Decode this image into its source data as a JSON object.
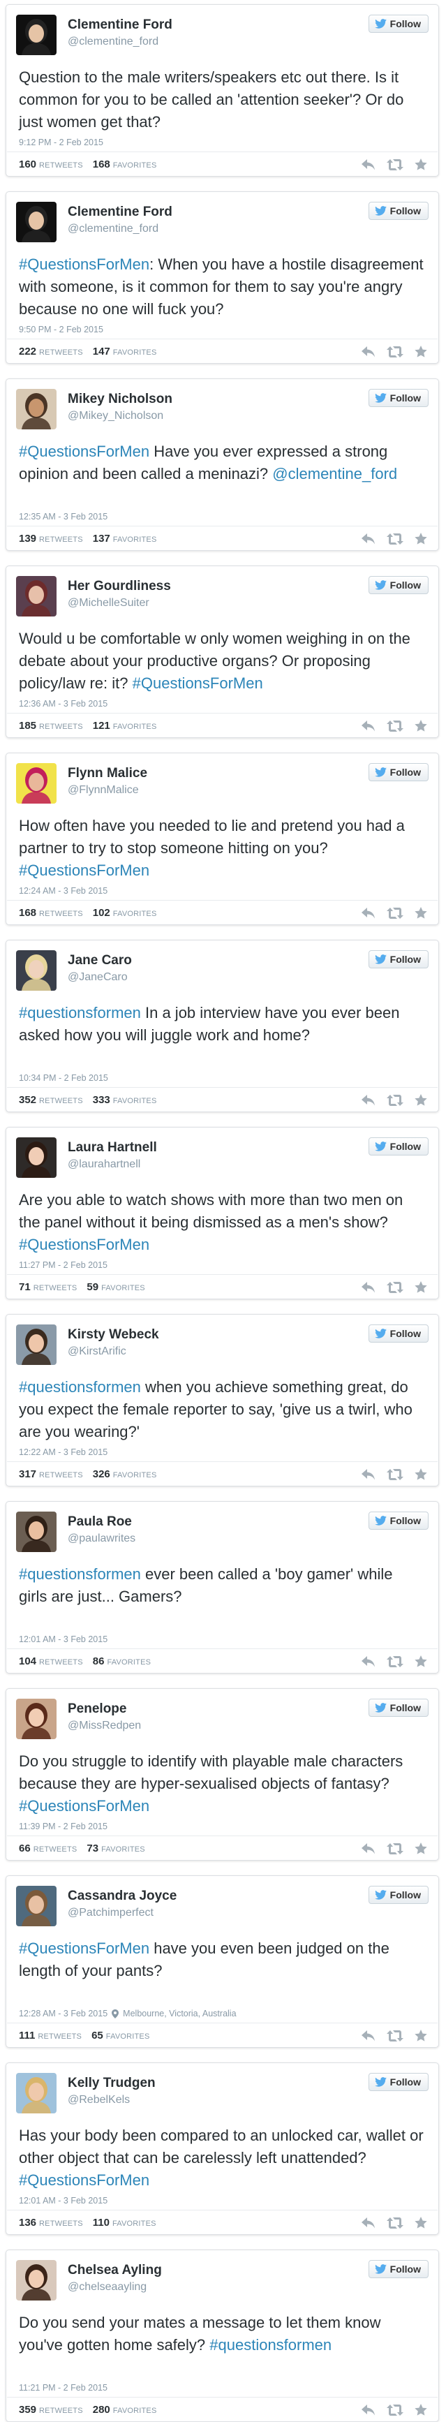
{
  "follow_label": "Follow",
  "retweets_label": "RETWEETS",
  "favorites_label": "FAVORITES",
  "colors": {
    "link": "#2c85b8",
    "twitter_blue": "#55acee",
    "muted": "#8899a6"
  },
  "tweets": [
    {
      "name": "Clementine Ford",
      "handle": "@clementine_ford",
      "parts": [
        {
          "t": "text",
          "v": "Question to the male writers/speakers etc out there. Is it common for you to be called an 'attention seeker'? Or do just women get that?"
        }
      ],
      "time": "9:12 PM - 2 Feb 2015",
      "location": "",
      "retweets": "160",
      "favorites": "168",
      "avatar": {
        "bg": "#101010",
        "face": "#e6c4a6",
        "hair": "#222222"
      }
    },
    {
      "name": "Clementine Ford",
      "handle": "@clementine_ford",
      "parts": [
        {
          "t": "tag",
          "v": "#QuestionsForMen"
        },
        {
          "t": "text",
          "v": ": When you have a hostile disagreement with someone, is it common for them to say you're angry because no one will fuck you?"
        }
      ],
      "time": "9:50 PM - 2 Feb 2015",
      "location": "",
      "retweets": "222",
      "favorites": "147",
      "avatar": {
        "bg": "#101010",
        "face": "#e6c4a6",
        "hair": "#222222"
      }
    },
    {
      "name": "Mikey Nicholson",
      "handle": "@Mikey_Nicholson",
      "parts": [
        {
          "t": "tag",
          "v": "#QuestionsForMen"
        },
        {
          "t": "text",
          "v": " Have you ever expressed a strong opinion and been called a meninazi? "
        },
        {
          "t": "mention",
          "v": "@clementine_ford"
        }
      ],
      "time": "12:35 AM - 3 Feb 2015",
      "location": "",
      "retweets": "139",
      "favorites": "137",
      "avatar": {
        "bg": "#d8c9b4",
        "face": "#c8966e",
        "hair": "#4a3526"
      }
    },
    {
      "name": "Her Gourdliness",
      "handle": "@MichelleSuiter",
      "parts": [
        {
          "t": "text",
          "v": "Would u be comfortable w only women weighing in on the debate about your productive organs? Or proposing policy/law re: it? "
        },
        {
          "t": "tag",
          "v": "#QuestionsForMen"
        }
      ],
      "time": "12:36 AM - 3 Feb 2015",
      "location": "",
      "retweets": "185",
      "favorites": "121",
      "avatar": {
        "bg": "#5a3f4e",
        "face": "#e7c0aa",
        "hair": "#6d2b2b"
      }
    },
    {
      "name": "Flynn Malice",
      "handle": "@FlynnMalice",
      "parts": [
        {
          "t": "text",
          "v": "How often have you needed to lie and pretend you had a partner to try to stop someone hitting on you? "
        },
        {
          "t": "tag",
          "v": "#QuestionsForMen"
        }
      ],
      "time": "12:24 AM - 3 Feb 2015",
      "location": "",
      "retweets": "168",
      "favorites": "102",
      "avatar": {
        "bg": "#f1e24a",
        "face": "#e9b79a",
        "hair": "#c21f5a"
      }
    },
    {
      "name": "Jane Caro",
      "handle": "@JaneCaro",
      "parts": [
        {
          "t": "tag",
          "v": "#questionsformen"
        },
        {
          "t": "text",
          "v": " In a job interview have you ever been asked how you will juggle work and home?"
        }
      ],
      "time": "10:34 PM - 2 Feb 2015",
      "location": "",
      "retweets": "352",
      "favorites": "333",
      "avatar": {
        "bg": "#3a3f4a",
        "face": "#efd2bd",
        "hair": "#e7d59a"
      }
    },
    {
      "name": "Laura Hartnell",
      "handle": "@laurahartnell",
      "parts": [
        {
          "t": "text",
          "v": "Are you able to watch shows with more than two men on the panel without it being dismissed as a men's show? "
        },
        {
          "t": "tag",
          "v": "#QuestionsForMen"
        }
      ],
      "time": "11:27 PM - 2 Feb 2015",
      "location": "",
      "retweets": "71",
      "favorites": "59",
      "avatar": {
        "bg": "#2e2a28",
        "face": "#f0cdb6",
        "hair": "#2b1a12"
      }
    },
    {
      "name": "Kirsty Webeck",
      "handle": "@KirstArific",
      "parts": [
        {
          "t": "tag",
          "v": "#questionsformen"
        },
        {
          "t": "text",
          "v": " when you achieve something great, do you expect the female reporter to say, 'give us a twirl, who are you wearing?'"
        }
      ],
      "time": "12:22 AM - 3 Feb 2015",
      "location": "",
      "retweets": "317",
      "favorites": "326",
      "avatar": {
        "bg": "#8a9aa8",
        "face": "#eec6aa",
        "hair": "#3a2a1e"
      }
    },
    {
      "name": "Paula Roe",
      "handle": "@paulawrites",
      "parts": [
        {
          "t": "tag",
          "v": "#questionsformen"
        },
        {
          "t": "text",
          "v": " ever been called a 'boy gamer' while girls are just... Gamers?"
        }
      ],
      "time": "12:01 AM - 3 Feb 2015",
      "location": "",
      "retweets": "104",
      "favorites": "86",
      "avatar": {
        "bg": "#6b5e52",
        "face": "#e9bfa0",
        "hair": "#2f2016"
      }
    },
    {
      "name": "Penelope",
      "handle": "@MissRedpen",
      "parts": [
        {
          "t": "text",
          "v": "Do you struggle to identify with playable male characters because they are hyper-sexualised objects of fantasy?"
        },
        {
          "t": "tag",
          "v": "#QuestionsForMen"
        }
      ],
      "time": "11:39 PM - 2 Feb 2015",
      "location": "",
      "retweets": "66",
      "favorites": "73",
      "avatar": {
        "bg": "#c9a58a",
        "face": "#f1cdb4",
        "hair": "#5a2a1a"
      }
    },
    {
      "name": "Cassandra Joyce",
      "handle": "@Patchimperfect",
      "parts": [
        {
          "t": "tag",
          "v": "#QuestionsForMen"
        },
        {
          "t": "text",
          "v": " have you even been judged on the length of your pants?"
        }
      ],
      "time": "12:28 AM - 3 Feb 2015",
      "location": "Melbourne, Victoria, Australia",
      "retweets": "111",
      "favorites": "65",
      "avatar": {
        "bg": "#4f6a7e",
        "face": "#e8c1a4",
        "hair": "#7c5a3a"
      }
    },
    {
      "name": "Kelly Trudgen",
      "handle": "@RebelKels",
      "parts": [
        {
          "t": "text",
          "v": "Has your body been compared to an unlocked car, wallet or other object that can be carelessly left unattended? "
        },
        {
          "t": "tag",
          "v": "#QuestionsForMen"
        }
      ],
      "time": "12:01 AM - 3 Feb 2015",
      "location": "",
      "retweets": "136",
      "favorites": "110",
      "avatar": {
        "bg": "#9fc2dc",
        "face": "#efc9ac",
        "hair": "#d9b56b"
      }
    },
    {
      "name": "Chelsea Ayling",
      "handle": "@chelseaayling",
      "parts": [
        {
          "t": "text",
          "v": "Do you send your mates a message to let them know you've gotten home safely? "
        },
        {
          "t": "tag",
          "v": "#questionsformen"
        }
      ],
      "time": "11:21 PM - 2 Feb 2015",
      "location": "",
      "retweets": "359",
      "favorites": "280",
      "avatar": {
        "bg": "#d9c9bc",
        "face": "#f0cdb4",
        "hair": "#3b2418"
      }
    }
  ]
}
